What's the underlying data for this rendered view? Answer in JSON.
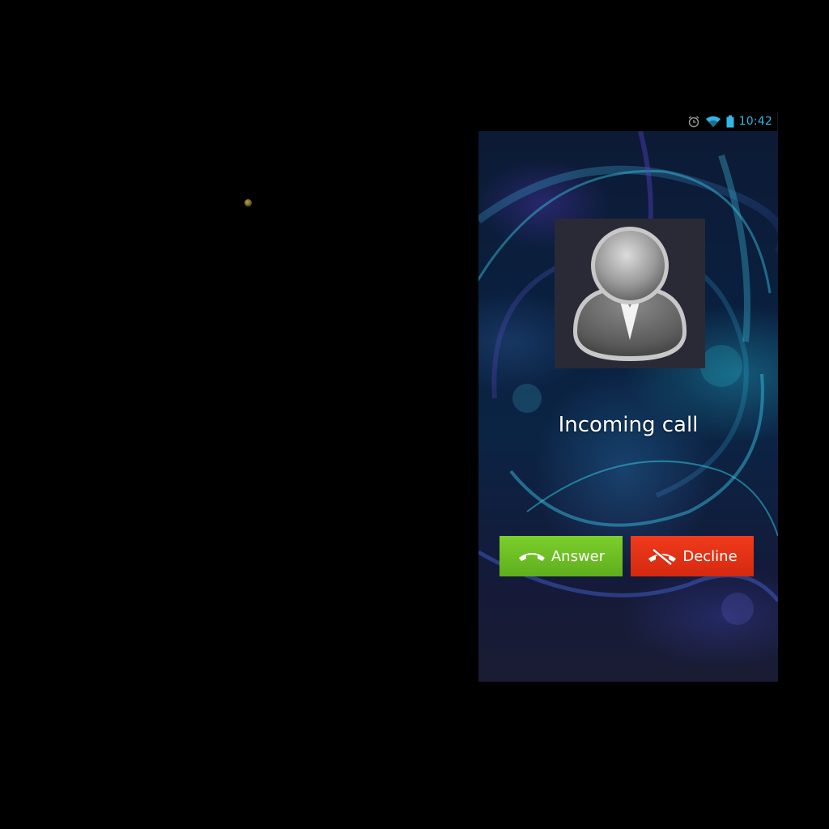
{
  "status_bar": {
    "time": "10:42",
    "icons": [
      "alarm-icon",
      "wifi-icon",
      "battery-icon"
    ],
    "accent_color": "#33b5e5"
  },
  "call_screen": {
    "avatar_icon": "default-contact-icon",
    "status_text": "Incoming call",
    "answer": {
      "label": "Answer",
      "icon": "phone-handset-icon",
      "color": "#6cbf24"
    },
    "decline": {
      "label": "Decline",
      "icon": "phone-hangup-icon",
      "color": "#e4331a"
    }
  }
}
